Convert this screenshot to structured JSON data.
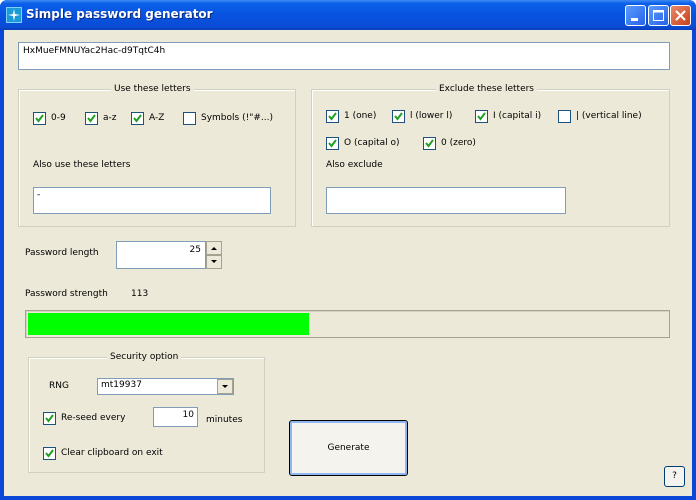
{
  "window": {
    "title": "Simple password generator"
  },
  "password_output": "HxMueFMNUYac2Hac-d9TqtC4h",
  "include_group": {
    "legend": "Use these letters",
    "options": [
      {
        "label": "0-9",
        "checked": true
      },
      {
        "label": "a-z",
        "checked": true
      },
      {
        "label": "A-Z",
        "checked": true
      },
      {
        "label": "Symbols (!\"#...)",
        "checked": false
      }
    ],
    "extra_label": "Also use these letters",
    "extra_value": "-"
  },
  "exclude_group": {
    "legend": "Exclude these letters",
    "options": [
      {
        "label": "1 (one)",
        "checked": true
      },
      {
        "label": "l (lower l)",
        "checked": true
      },
      {
        "label": "I (capital i)",
        "checked": true
      },
      {
        "label": "| (vertical line)",
        "checked": false
      },
      {
        "label": "O (capital o)",
        "checked": true
      },
      {
        "label": "0 (zero)",
        "checked": true
      }
    ],
    "extra_label": "Also exclude",
    "extra_value": ""
  },
  "length": {
    "label": "Password length",
    "value": "25"
  },
  "strength": {
    "label": "Password strength",
    "value": "113",
    "fill_fraction": 0.44,
    "fill_color": "#00ff00"
  },
  "security": {
    "legend": "Security option",
    "rng_label": "RNG",
    "rng_value": "mt19937",
    "reseed_checked": true,
    "reseed_label": "Re-seed every",
    "reseed_value": "10",
    "reseed_unit": "minutes",
    "clear_checked": true,
    "clear_label": "Clear clipboard on exit"
  },
  "buttons": {
    "generate": "Generate",
    "help": "?"
  }
}
